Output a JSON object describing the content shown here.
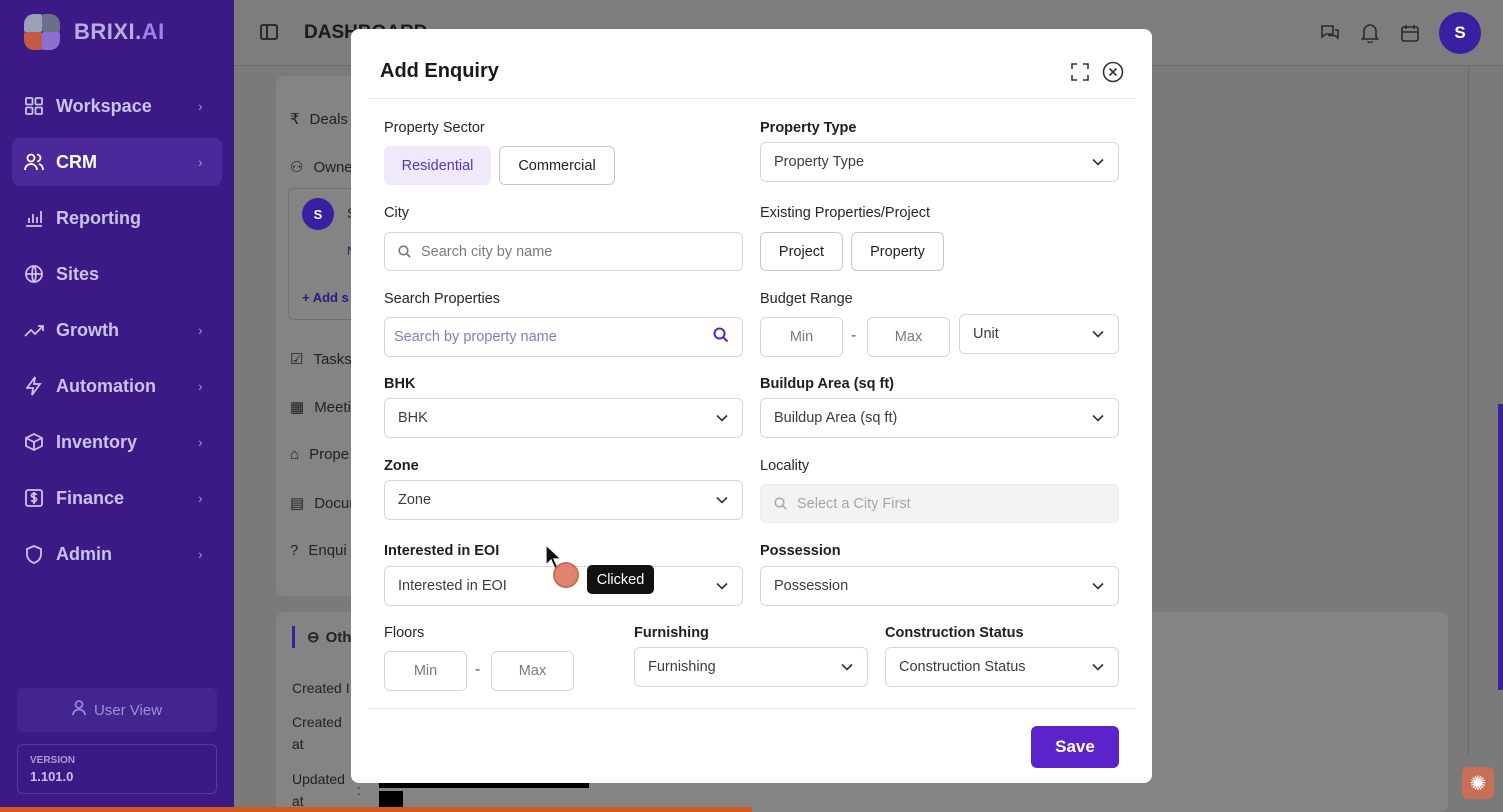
{
  "brand": {
    "name_main": "BRIXI.",
    "name_suffix": "AI"
  },
  "sidebar": {
    "items": [
      {
        "label": "Workspace",
        "icon": "grid-icon",
        "has_chevron": true
      },
      {
        "label": "CRM",
        "icon": "users-icon",
        "has_chevron": true,
        "active": true
      },
      {
        "label": "Reporting",
        "icon": "bar-chart-icon",
        "has_chevron": false
      },
      {
        "label": "Sites",
        "icon": "globe-icon",
        "has_chevron": false
      },
      {
        "label": "Growth",
        "icon": "trend-icon",
        "has_chevron": true
      },
      {
        "label": "Automation",
        "icon": "bolt-icon",
        "has_chevron": true
      },
      {
        "label": "Inventory",
        "icon": "box-icon",
        "has_chevron": true
      },
      {
        "label": "Finance",
        "icon": "dollar-icon",
        "has_chevron": true
      },
      {
        "label": "Admin",
        "icon": "shield-icon",
        "has_chevron": true
      }
    ],
    "user_view_label": "User View",
    "version_label": "VERSION",
    "version_number": "1.101.0"
  },
  "header": {
    "title": "DASHBOARD",
    "avatar_initial": "S"
  },
  "background": {
    "rows": [
      "Deals",
      "Owne",
      "Tasks",
      "Meeti",
      "Prope",
      "Docur",
      "Enqui"
    ],
    "owner_avatar_initial": "S",
    "owner_letter_s": "S",
    "owner_letter_n": "N",
    "add_label": "+ Add s",
    "other_label": "Oth",
    "created_by_label": "Created I",
    "created_at_label_1": "Created",
    "created_at_label_2": "at",
    "updated_at_label_1": "Updated",
    "updated_at_label_2": "at",
    "colon": ":"
  },
  "modal": {
    "title": "Add Enquiry",
    "property_sector": {
      "label": "Property Sector",
      "options": [
        "Residential",
        "Commercial"
      ],
      "selected": "Residential"
    },
    "property_type": {
      "label": "Property Type",
      "placeholder": "Property Type"
    },
    "city": {
      "label": "City",
      "placeholder": "Search city by name"
    },
    "existing": {
      "label": "Existing Properties/Project",
      "options": [
        "Project",
        "Property"
      ]
    },
    "search_properties": {
      "label": "Search Properties",
      "placeholder": "Search by property name"
    },
    "budget": {
      "label": "Budget Range",
      "min": "Min",
      "max": "Max",
      "unit": "Unit",
      "separator": "-"
    },
    "bhk": {
      "label": "BHK",
      "value": "BHK"
    },
    "buildup": {
      "label": "Buildup Area (sq ft)",
      "value": "Buildup Area (sq ft)"
    },
    "zone": {
      "label": "Zone",
      "value": "Zone"
    },
    "locality": {
      "label": "Locality",
      "placeholder": "Select a City First"
    },
    "eoi": {
      "label": "Interested in EOI",
      "value": "Interested in EOI"
    },
    "possession": {
      "label": "Possession",
      "value": "Possession"
    },
    "floors": {
      "label": "Floors",
      "min": "Min",
      "max": "Max",
      "separator": "-"
    },
    "furnishing": {
      "label": "Furnishing",
      "value": "Furnishing"
    },
    "construction": {
      "label": "Construction Status",
      "value": "Construction Status"
    },
    "save_label": "Save"
  },
  "overlay": {
    "tooltip": "Clicked"
  },
  "colors": {
    "sidebar_bg": "#3b1a86",
    "accent": "#5b23c9",
    "selected_seg_bg": "#efe9fb"
  }
}
